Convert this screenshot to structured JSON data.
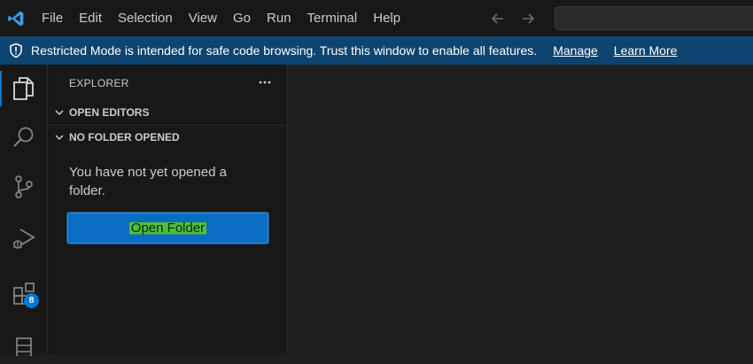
{
  "titlebar": {
    "app_icon": "vscode-logo",
    "menu": [
      "File",
      "Edit",
      "Selection",
      "View",
      "Go",
      "Run",
      "Terminal",
      "Help"
    ],
    "back_icon": "arrow-left-icon",
    "forward_icon": "arrow-right-icon",
    "command_center_value": ""
  },
  "banner": {
    "icon": "shield-icon",
    "text": "Restricted Mode is intended for safe code browsing. Trust this window to enable all features.",
    "manage_label": "Manage",
    "learn_more_label": "Learn More",
    "background": "#0e4470"
  },
  "activity_bar": {
    "items": [
      "explorer-icon",
      "search-icon",
      "source-control-icon",
      "run-debug-icon",
      "extensions-icon",
      "remote-explorer-icon"
    ],
    "extensions_badge": "8",
    "accent": "#0078d4"
  },
  "sidebar": {
    "title": "EXPLORER",
    "sections": [
      {
        "label": "OPEN EDITORS",
        "expanded": false
      },
      {
        "label": "NO FOLDER OPENED",
        "expanded": true
      }
    ],
    "empty_message": "You have not yet opened a folder.",
    "open_folder_label": "Open Folder"
  },
  "colors": {
    "primary_button": "#0a6dc2",
    "highlight": "#4fbf3a"
  }
}
